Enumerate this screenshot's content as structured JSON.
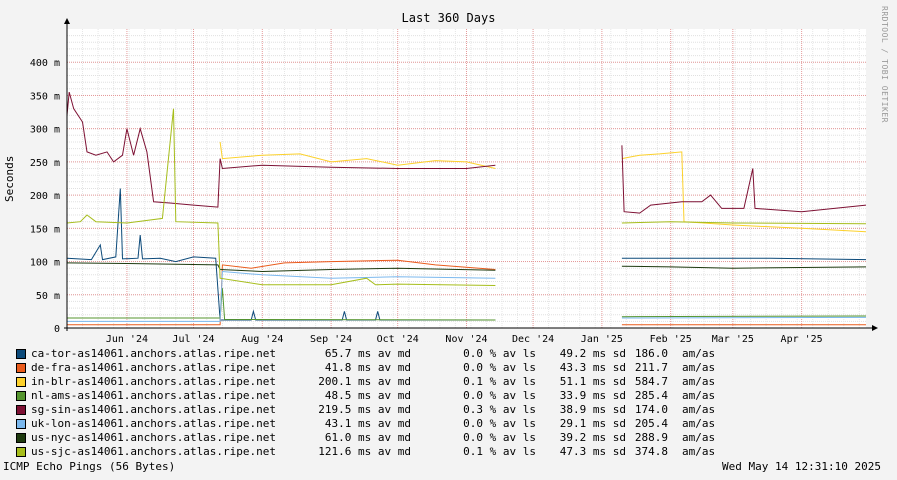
{
  "watermark": "RRDTOOL / TOBI OETIKER",
  "footer": {
    "left": "ICMP Echo Pings (56 Bytes)",
    "right": "Wed May 14 12:31:10 2025"
  },
  "legend": [
    {
      "name": "ca-tor-as14061.anchors.atlas.ripe.net",
      "color": "#0c4a7a",
      "median": "65.7 ms av md",
      "loss": "0.0 % av ls",
      "sd": "49.2 ms sd",
      "ratio": "186.0",
      "unit": "am/as"
    },
    {
      "name": "de-fra-as14061.anchors.atlas.ripe.net",
      "color": "#ea5b1c",
      "median": "41.8 ms av md",
      "loss": "0.0 % av ls",
      "sd": "43.3 ms sd",
      "ratio": "211.7",
      "unit": "am/as"
    },
    {
      "name": "in-blr-as14061.anchors.atlas.ripe.net",
      "color": "#fcd12b",
      "median": "200.1 ms av md",
      "loss": "0.1 % av ls",
      "sd": "51.1 ms sd",
      "ratio": "584.7",
      "unit": "am/as"
    },
    {
      "name": "nl-ams-as14061.anchors.atlas.ripe.net",
      "color": "#55952e",
      "median": "48.5 ms av md",
      "loss": "0.0 % av ls",
      "sd": "33.9 ms sd",
      "ratio": "285.4",
      "unit": "am/as"
    },
    {
      "name": "sg-sin-as14061.anchors.atlas.ripe.net",
      "color": "#7d1033",
      "median": "219.5 ms av md",
      "loss": "0.3 % av ls",
      "sd": "38.9 ms sd",
      "ratio": "174.0",
      "unit": "am/as"
    },
    {
      "name": "uk-lon-as14061.anchors.atlas.ripe.net",
      "color": "#7bb8ee",
      "median": "43.1 ms av md",
      "loss": "0.0 % av ls",
      "sd": "29.1 ms sd",
      "ratio": "205.4",
      "unit": "am/as"
    },
    {
      "name": "us-nyc-as14061.anchors.atlas.ripe.net",
      "color": "#1e3a0f",
      "median": "61.0 ms av md",
      "loss": "0.0 % av ls",
      "sd": "39.2 ms sd",
      "ratio": "288.9",
      "unit": "am/as"
    },
    {
      "name": "us-sjc-as14061.anchors.atlas.ripe.net",
      "color": "#a6bd1b",
      "median": "121.6 ms av md",
      "loss": "0.1 % av ls",
      "sd": "47.3 ms sd",
      "ratio": "374.8",
      "unit": "am/as"
    }
  ],
  "chart_data": {
    "type": "line",
    "title": "Last 360 Days",
    "ylabel": "Seconds",
    "xlabel": "",
    "ylim": [
      0,
      0.45
    ],
    "yticks": [
      {
        "v": 0,
        "label": "0"
      },
      {
        "v": 0.05,
        "label": "50 m"
      },
      {
        "v": 0.1,
        "label": "100 m"
      },
      {
        "v": 0.15,
        "label": "150 m"
      },
      {
        "v": 0.2,
        "label": "200 m"
      },
      {
        "v": 0.25,
        "label": "250 m"
      },
      {
        "v": 0.3,
        "label": "300 m"
      },
      {
        "v": 0.35,
        "label": "350 m"
      },
      {
        "v": 0.4,
        "label": "400 m"
      }
    ],
    "xlim": [
      "2024-05-19",
      "2025-05-14"
    ],
    "xticks": [
      {
        "date": "2024-06-15",
        "label": "Jun '24"
      },
      {
        "date": "2024-07-15",
        "label": "Jul '24"
      },
      {
        "date": "2024-08-15",
        "label": "Aug '24"
      },
      {
        "date": "2024-09-15",
        "label": "Sep '24"
      },
      {
        "date": "2024-10-15",
        "label": "Oct '24"
      },
      {
        "date": "2024-11-15",
        "label": "Nov '24"
      },
      {
        "date": "2024-12-15",
        "label": "Dec '24"
      },
      {
        "date": "2025-01-15",
        "label": "Jan '25"
      },
      {
        "date": "2025-02-15",
        "label": "Feb '25"
      },
      {
        "date": "2025-03-15",
        "label": "Mar '25"
      },
      {
        "date": "2025-04-15",
        "label": "Apr '25"
      }
    ],
    "grid": true,
    "legend_position": "bottom",
    "series": [
      {
        "name": "ca-tor-as14061.anchors.atlas.ripe.net",
        "color": "#0c4a7a",
        "points": [
          [
            "2024-05-19",
            0.105
          ],
          [
            "2024-05-30",
            0.103
          ],
          [
            "2024-06-03",
            0.125
          ],
          [
            "2024-06-04",
            0.103
          ],
          [
            "2024-06-10",
            0.107
          ],
          [
            "2024-06-12",
            0.21
          ],
          [
            "2024-06-13",
            0.104
          ],
          [
            "2024-06-20",
            0.105
          ],
          [
            "2024-06-21",
            0.14
          ],
          [
            "2024-06-22",
            0.104
          ],
          [
            "2024-06-30",
            0.105
          ],
          [
            "2024-07-07",
            0.1
          ],
          [
            "2024-07-15",
            0.107
          ],
          [
            "2024-07-25",
            0.105
          ],
          [
            "2024-07-27",
            0.012
          ],
          [
            "2024-08-10",
            0.012
          ],
          [
            "2024-08-11",
            0.025
          ],
          [
            "2024-08-12",
            0.012
          ],
          [
            "2024-09-20",
            0.012
          ],
          [
            "2024-09-21",
            0.025
          ],
          [
            "2024-09-22",
            0.012
          ],
          [
            "2024-10-05",
            0.012
          ],
          [
            "2024-10-06",
            0.025
          ],
          [
            "2024-10-07",
            0.012
          ],
          [
            "2024-11-28",
            0.012
          ],
          null,
          [
            "2025-01-24",
            0.105
          ],
          [
            "2025-03-01",
            0.105
          ],
          [
            "2025-04-01",
            0.105
          ],
          [
            "2025-05-14",
            0.103
          ]
        ]
      },
      {
        "name": "de-fra-as14061.anchors.atlas.ripe.net",
        "color": "#ea5b1c",
        "points": [
          [
            "2024-05-19",
            0.005
          ],
          [
            "2024-07-27",
            0.005
          ],
          [
            "2024-07-28",
            0.095
          ],
          [
            "2024-08-10",
            0.09
          ],
          [
            "2024-08-25",
            0.098
          ],
          [
            "2024-09-15",
            0.1
          ],
          [
            "2024-10-15",
            0.102
          ],
          [
            "2024-11-01",
            0.095
          ],
          [
            "2024-11-28",
            0.088
          ],
          null,
          [
            "2025-01-24",
            0.005
          ],
          [
            "2025-05-14",
            0.005
          ]
        ]
      },
      {
        "name": "in-blr-as14061.anchors.atlas.ripe.net",
        "color": "#fcd12b",
        "points": [
          [
            "2024-07-27",
            0.28
          ],
          [
            "2024-07-28",
            0.255
          ],
          [
            "2024-08-15",
            0.26
          ],
          [
            "2024-09-01",
            0.262
          ],
          [
            "2024-09-15",
            0.25
          ],
          [
            "2024-10-01",
            0.255
          ],
          [
            "2024-10-15",
            0.245
          ],
          [
            "2024-11-01",
            0.252
          ],
          [
            "2024-11-15",
            0.25
          ],
          [
            "2024-11-28",
            0.24
          ],
          null,
          [
            "2025-01-24",
            0.255
          ],
          [
            "2025-02-01",
            0.26
          ],
          [
            "2025-02-10",
            0.262
          ],
          [
            "2025-02-20",
            0.265
          ],
          [
            "2025-02-21",
            0.16
          ],
          [
            "2025-03-15",
            0.155
          ],
          [
            "2025-04-15",
            0.15
          ],
          [
            "2025-05-14",
            0.145
          ]
        ]
      },
      {
        "name": "nl-ams-as14061.anchors.atlas.ripe.net",
        "color": "#55952e",
        "points": [
          [
            "2024-05-19",
            0.015
          ],
          [
            "2024-07-27",
            0.015
          ],
          [
            "2024-07-28",
            0.06
          ],
          [
            "2024-07-29",
            0.013
          ],
          [
            "2024-11-28",
            0.012
          ],
          null,
          [
            "2025-01-24",
            0.017
          ],
          [
            "2025-05-14",
            0.018
          ]
        ]
      },
      {
        "name": "sg-sin-as14061.anchors.atlas.ripe.net",
        "color": "#7d1033",
        "points": [
          [
            "2024-05-19",
            0.32
          ],
          [
            "2024-05-20",
            0.355
          ],
          [
            "2024-05-22",
            0.33
          ],
          [
            "2024-05-26",
            0.31
          ],
          [
            "2024-05-28",
            0.265
          ],
          [
            "2024-06-01",
            0.26
          ],
          [
            "2024-06-06",
            0.265
          ],
          [
            "2024-06-09",
            0.25
          ],
          [
            "2024-06-13",
            0.26
          ],
          [
            "2024-06-15",
            0.3
          ],
          [
            "2024-06-18",
            0.26
          ],
          [
            "2024-06-21",
            0.3
          ],
          [
            "2024-06-24",
            0.265
          ],
          [
            "2024-06-27",
            0.19
          ],
          [
            "2024-07-05",
            0.188
          ],
          [
            "2024-07-15",
            0.185
          ],
          [
            "2024-07-26",
            0.182
          ],
          [
            "2024-07-27",
            0.255
          ],
          [
            "2024-07-28",
            0.24
          ],
          [
            "2024-08-15",
            0.245
          ],
          [
            "2024-09-15",
            0.242
          ],
          [
            "2024-10-15",
            0.24
          ],
          [
            "2024-11-15",
            0.24
          ],
          [
            "2024-11-28",
            0.245
          ],
          null,
          [
            "2025-01-24",
            0.275
          ],
          [
            "2025-01-25",
            0.175
          ],
          [
            "2025-02-01",
            0.173
          ],
          [
            "2025-02-06",
            0.185
          ],
          [
            "2025-02-20",
            0.19
          ],
          [
            "2025-03-01",
            0.19
          ],
          [
            "2025-03-05",
            0.2
          ],
          [
            "2025-03-10",
            0.18
          ],
          [
            "2025-03-20",
            0.18
          ],
          [
            "2025-03-24",
            0.24
          ],
          [
            "2025-03-25",
            0.18
          ],
          [
            "2025-04-15",
            0.175
          ],
          [
            "2025-05-14",
            0.185
          ]
        ]
      },
      {
        "name": "uk-lon-as14061.anchors.atlas.ripe.net",
        "color": "#7bb8ee",
        "points": [
          [
            "2024-05-19",
            0.01
          ],
          [
            "2024-07-27",
            0.01
          ],
          [
            "2024-07-28",
            0.085
          ],
          [
            "2024-08-15",
            0.08
          ],
          [
            "2024-09-15",
            0.075
          ],
          [
            "2024-10-15",
            0.077
          ],
          [
            "2024-11-28",
            0.075
          ],
          null,
          [
            "2025-01-24",
            0.015
          ],
          [
            "2025-05-14",
            0.016
          ]
        ]
      },
      {
        "name": "us-nyc-as14061.anchors.atlas.ripe.net",
        "color": "#1e3a0f",
        "points": [
          [
            "2024-05-19",
            0.098
          ],
          [
            "2024-06-15",
            0.097
          ],
          [
            "2024-07-26",
            0.095
          ],
          [
            "2024-07-27",
            0.088
          ],
          [
            "2024-08-15",
            0.085
          ],
          [
            "2024-09-15",
            0.088
          ],
          [
            "2024-10-15",
            0.09
          ],
          [
            "2024-11-28",
            0.087
          ],
          null,
          [
            "2025-01-24",
            0.093
          ],
          [
            "2025-02-15",
            0.092
          ],
          [
            "2025-03-15",
            0.09
          ],
          [
            "2025-05-14",
            0.092
          ]
        ]
      },
      {
        "name": "us-sjc-as14061.anchors.atlas.ripe.net",
        "color": "#a6bd1b",
        "points": [
          [
            "2024-05-19",
            0.158
          ],
          [
            "2024-05-25",
            0.16
          ],
          [
            "2024-05-28",
            0.17
          ],
          [
            "2024-06-01",
            0.16
          ],
          [
            "2024-06-15",
            0.158
          ],
          [
            "2024-07-01",
            0.165
          ],
          [
            "2024-07-06",
            0.33
          ],
          [
            "2024-07-07",
            0.16
          ],
          [
            "2024-07-26",
            0.158
          ],
          [
            "2024-07-27",
            0.075
          ],
          [
            "2024-08-15",
            0.065
          ],
          [
            "2024-09-15",
            0.065
          ],
          [
            "2024-10-01",
            0.075
          ],
          [
            "2024-10-05",
            0.065
          ],
          [
            "2024-10-15",
            0.066
          ],
          [
            "2024-11-28",
            0.064
          ],
          null,
          [
            "2025-01-24",
            0.158
          ],
          [
            "2025-02-15",
            0.16
          ],
          [
            "2025-03-15",
            0.158
          ],
          [
            "2025-05-14",
            0.157
          ]
        ]
      }
    ]
  }
}
